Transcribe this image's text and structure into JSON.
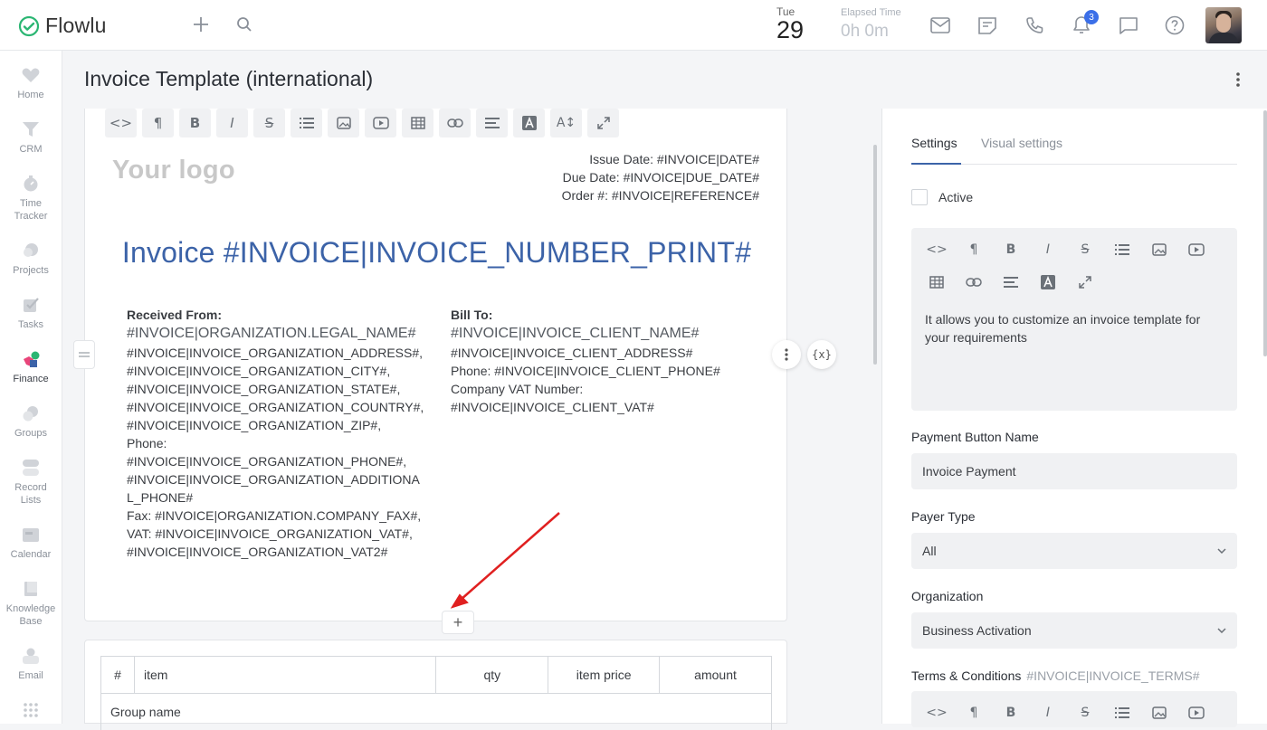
{
  "app": {
    "name": "Flowlu",
    "brand_color": "#3c63a8",
    "accent_green": "#2bb673"
  },
  "topbar": {
    "date_dow": "Tue",
    "date_day": "29",
    "elapsed_label": "Elapsed Time",
    "elapsed_value": "0h 0m",
    "notification_count": "3",
    "icons": [
      "plus-icon",
      "search-icon",
      "mail-icon",
      "notes-icon",
      "phone-icon",
      "bell-icon",
      "chat-icon",
      "help-icon"
    ]
  },
  "sidebar": {
    "items": [
      {
        "label": "Home"
      },
      {
        "label": "CRM"
      },
      {
        "label": "Time",
        "label2": "Tracker"
      },
      {
        "label": "Projects"
      },
      {
        "label": "Tasks"
      },
      {
        "label": "Finance"
      },
      {
        "label": "Groups"
      },
      {
        "label": "Record",
        "label2": "Lists"
      },
      {
        "label": "Calendar"
      },
      {
        "label": "Knowledge",
        "label2": "Base"
      },
      {
        "label": "Email"
      }
    ]
  },
  "page": {
    "title": "Invoice Template (international)"
  },
  "editor": {
    "toolbar": [
      "<>",
      "¶",
      "B",
      "I",
      "S",
      "list",
      "image",
      "video",
      "table",
      "link",
      "align",
      "A",
      "A↕",
      "expand"
    ],
    "logo_text": "Your logo",
    "issue_date": "Issue Date: #INVOICE|DATE#",
    "due_date": "Due Date: #INVOICE|DUE_DATE#",
    "order": "Order #: #INVOICE|REFERENCE#",
    "invoice_title": "Invoice #INVOICE|INVOICE_NUMBER_PRINT#",
    "received_from": {
      "heading": "Received From:",
      "name": "#INVOICE|ORGANIZATION.LEGAL_NAME#",
      "lines": [
        "#INVOICE|INVOICE_ORGANIZATION_ADDRESS#,",
        "#INVOICE|INVOICE_ORGANIZATION_CITY#,",
        "#INVOICE|INVOICE_ORGANIZATION_STATE#,",
        "#INVOICE|INVOICE_ORGANIZATION_COUNTRY#,",
        "#INVOICE|INVOICE_ORGANIZATION_ZIP#,",
        "Phone:",
        "#INVOICE|INVOICE_ORGANIZATION_PHONE#,",
        "#INVOICE|INVOICE_ORGANIZATION_ADDITIONA",
        "L_PHONE#",
        "Fax: #INVOICE|ORGANIZATION.COMPANY_FAX#,",
        "VAT: #INVOICE|INVOICE_ORGANIZATION_VAT#,",
        "#INVOICE|INVOICE_ORGANIZATION_VAT2#"
      ]
    },
    "bill_to": {
      "heading": "Bill To:",
      "name": "#INVOICE|INVOICE_CLIENT_NAME#",
      "lines": [
        "#INVOICE|INVOICE_CLIENT_ADDRESS#",
        "Phone: #INVOICE|INVOICE_CLIENT_PHONE#",
        "Company VAT Number:",
        "#INVOICE|INVOICE_CLIENT_VAT#"
      ]
    },
    "variable_button": "{x}",
    "add_block": "+"
  },
  "items_table": {
    "headers": [
      "#",
      "item",
      "qty",
      "item price",
      "amount"
    ],
    "group_row": "Group name"
  },
  "settings": {
    "tabs": [
      "Settings",
      "Visual settings"
    ],
    "active_label": "Active",
    "description": "It allows you to customize an invoice template for your requirements",
    "payment_button_label": "Payment Button Name",
    "payment_button_value": "Invoice Payment",
    "payer_type_label": "Payer Type",
    "payer_type_value": "All",
    "organization_label": "Organization",
    "organization_value": "Business Activation",
    "terms_label": "Terms & Conditions",
    "terms_tag": "#INVOICE|INVOICE_TERMS#"
  }
}
